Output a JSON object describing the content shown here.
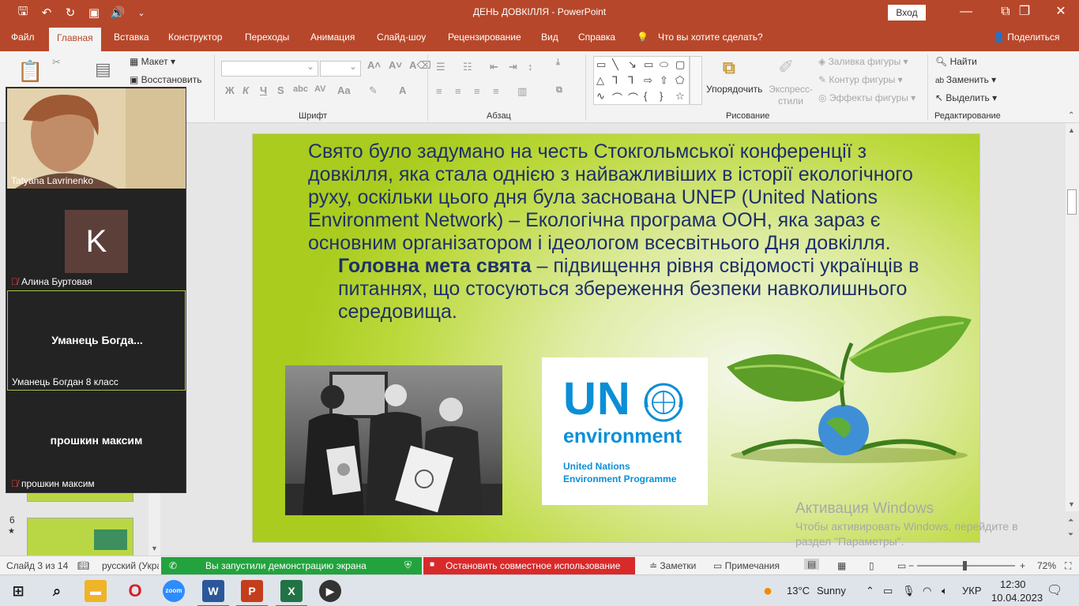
{
  "window": {
    "title": "ДЕНЬ ДОВКІЛЛЯ  -  PowerPoint",
    "signin": "Вход",
    "quick_access": [
      "save-icon",
      "undo-icon",
      "redo-icon",
      "present-icon",
      "audio-icon",
      "customize-icon"
    ]
  },
  "tabs": {
    "items": [
      "Файл",
      "Главная",
      "Вставка",
      "Конструктор",
      "Переходы",
      "Анимация",
      "Слайд-шоу",
      "Рецензирование",
      "Вид",
      "Справка"
    ],
    "active": "Главная",
    "tell_me": "Что вы хотите сделать?",
    "share": "Поделиться"
  },
  "ribbon": {
    "slides": {
      "layout": "Макет",
      "reset": "Восстановить"
    },
    "font_group": "Шрифт",
    "paragraph_group": "Абзац",
    "drawing_group": "Рисование",
    "editing_group": "Редактирование",
    "arrange": "Упорядочить",
    "quick_styles": "Экспресс-\nстили",
    "shape_fill": "Заливка фигуры",
    "shape_outline": "Контур фигуры",
    "shape_effects": "Эффекты фигуры",
    "find": "Найти",
    "replace": "Заменить",
    "select": "Выделить"
  },
  "slide": {
    "para1": "Свято було задумано на честь Стокгольмської конференції з довкілля, яка стала однією з найважливіших в історії екологічного руху, оскільки цього дня була заснована UNEP (United Nations Environment Network) – Екологічна програма ООН, яка зараз є основним організатором і ідеологом всесвітнього Дня довкілля.",
    "para2_bold": "Головна мета свята",
    "para2_rest": " – підвищення рівня свідомості українців в питаннях, що стосуються збереження безпеки навколишнього середовища.",
    "logo": {
      "main": "UN",
      "env": "environment",
      "line1": "United Nations",
      "line2": "Environment Programme"
    },
    "watermark_title": "Активация Windows",
    "watermark_text": "Чтобы активировать Windows, перейдите в раздел \"Параметры\"."
  },
  "thumbnails": {
    "visible_number": "6",
    "star": "★"
  },
  "video_panel": {
    "participants": [
      {
        "name": "Tatyana Lavrinenko",
        "muted": false,
        "has_video": true
      },
      {
        "name": "Алина Буртовая",
        "muted": true,
        "avatar_letter": "K"
      },
      {
        "name": "Уманець Богдан 8 класс",
        "center_label": "Уманець  Богда...",
        "muted": false,
        "active_speaker": true
      },
      {
        "name": "прошкин максим",
        "center_label": "прошкин максим",
        "muted": true
      }
    ]
  },
  "statusbar": {
    "slide_counter": "Слайд 3 из 14",
    "language": "русский (Украина)",
    "share_message": "Вы запустили демонстрацию экрана",
    "stop_share": "Остановить совместное использование",
    "notes": "Заметки",
    "comments": "Примечания",
    "zoom_minus": "−",
    "zoom_plus": "+",
    "zoom": "72%"
  },
  "taskbar": {
    "apps": [
      "start-icon",
      "search-icon",
      "file-explorer-icon",
      "opera-icon",
      "zoom-icon",
      "word-icon",
      "powerpoint-icon",
      "excel-icon",
      "media-player-icon"
    ],
    "weather_temp": "13°C",
    "weather_text": "Sunny",
    "keyboard_lang": "УКР",
    "time": "12:30",
    "date": "10.04.2023"
  },
  "colors": {
    "accent": "#b7472a",
    "slide_text": "#1f2f6b",
    "un_blue": "#0a8fd6",
    "share_green": "#23a33e",
    "share_red": "#d92a2a"
  }
}
